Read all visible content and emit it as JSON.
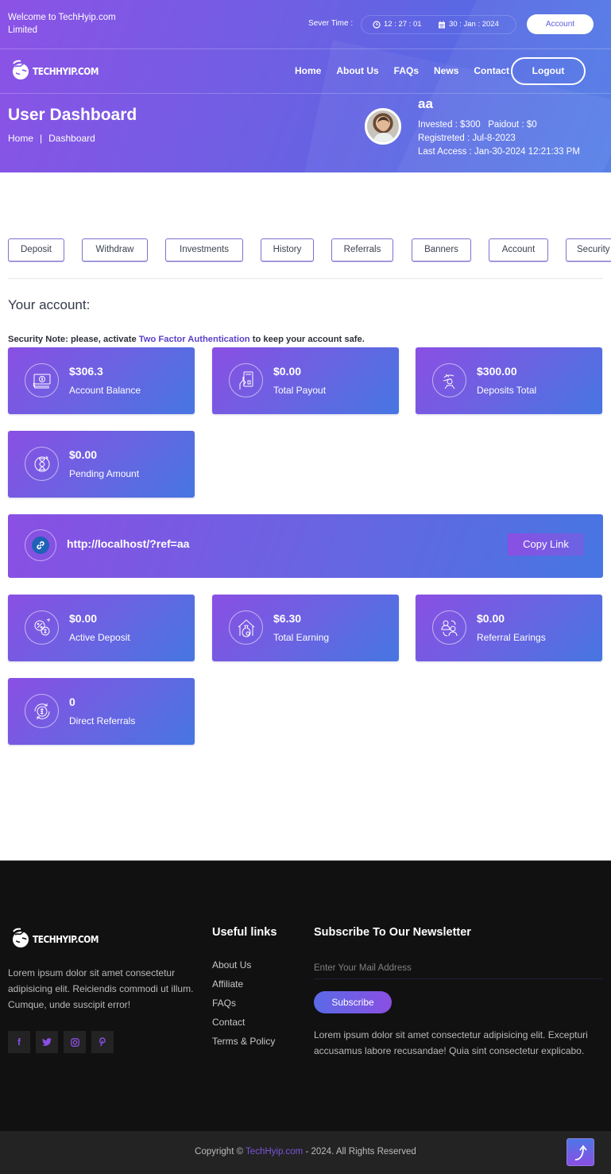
{
  "topbar": {
    "welcome": "Welcome to TechHyip.com Limited",
    "server_time_label": "Sever Time :",
    "time": "12 : 27 : 01",
    "date": "30 : Jan : 2024",
    "account_button": "Account"
  },
  "navbar": {
    "logo": "TECHHYIP.COM",
    "links": [
      "Home",
      "About Us",
      "FAQs",
      "News",
      "Contact"
    ],
    "logout_button": "Logout"
  },
  "hero": {
    "title": "User Dashboard",
    "breadcrumb": [
      "Home",
      "|",
      "Dashboard"
    ],
    "user": {
      "name": "aa",
      "invested": "Invested  : $300",
      "paidout": "Paidout  : $0",
      "registered": "Registreted  : Jul-8-2023",
      "last_access": "Last Access  : Jan-30-2024 12:21:33 PM"
    }
  },
  "tabs": [
    "Deposit",
    "Withdraw",
    "Investments",
    "History",
    "Referrals",
    "Banners",
    "Account",
    "Security"
  ],
  "main": {
    "heading": "Your account:",
    "security_note_prefix": "Security Note: please, activate ",
    "security_note_link": "Two Factor Authentication",
    "security_note_suffix": " to keep your account safe.",
    "stats_top": [
      {
        "value": "$306.3",
        "label": "Account Balance",
        "icon": "cash-icon"
      },
      {
        "value": "$0.00",
        "label": "Total Payout",
        "icon": "card-payout-icon"
      },
      {
        "value": "$300.00",
        "label": "Deposits Total",
        "icon": "hand-deposit-icon"
      },
      {
        "value": "$0.00",
        "label": "Pending Amount",
        "icon": "hourglass-icon"
      }
    ],
    "referral_link": {
      "url": "http://localhost/?ref=aa",
      "copy_button": "Copy Link",
      "icon": "link-icon"
    },
    "stats_bottom": [
      {
        "value": "$0.00",
        "label": "Active Deposit",
        "icon": "percent-coin-icon"
      },
      {
        "value": "$6.30",
        "label": "Total Earning",
        "icon": "house-moneybag-icon"
      },
      {
        "value": "$0.00",
        "label": "Referral Earings",
        "icon": "people-exchange-icon"
      },
      {
        "value": "0",
        "label": "Direct Referrals",
        "icon": "dollar-cycle-icon"
      }
    ]
  },
  "footer": {
    "logo": "TECHHYIP.COM",
    "about": "Lorem ipsum dolor sit amet consectetur adipisicing elit. Reiciendis commodi ut illum. Cumque, unde suscipit error!",
    "socials": [
      "facebook",
      "twitter",
      "instagram",
      "pinterest"
    ],
    "useful_links_heading": "Useful links",
    "useful_links": [
      "About Us",
      "Affiliate",
      "FAQs",
      "Contact",
      "Terms & Policy"
    ],
    "newsletter_heading": "Subscribe To Our Newsletter",
    "newsletter_placeholder": "Enter Your Mail Address",
    "subscribe_button": "Subscribe",
    "newsletter_text": "Lorem ipsum dolor sit amet consectetur adipisicing elit. Excepturi accusamus labore recusandae! Quia sint consectetur explicabo.",
    "copyright_prefix": "Copyright © ",
    "copyright_brand": "TechHyip.com",
    "copyright_suffix": " - 2024. All Rights Reserved"
  },
  "colors": {
    "gradient_start": "#8a4fe3",
    "gradient_end": "#4676e2",
    "accent_link": "#5b3fc7",
    "footer_bg": "#111111",
    "bottombar_bg": "#232323"
  }
}
